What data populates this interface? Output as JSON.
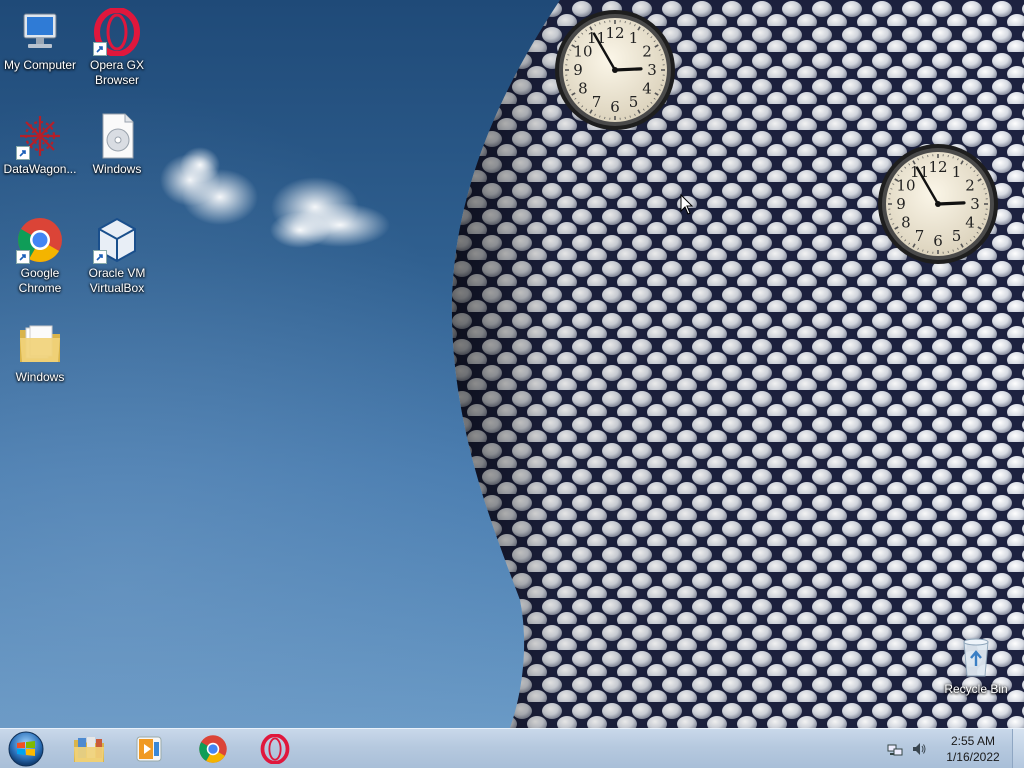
{
  "desktop": {
    "icons": [
      {
        "label": "My Computer",
        "icon": "computer-icon"
      },
      {
        "label": "Opera GX Browser",
        "icon": "opera-gx-icon",
        "shortcut": true
      },
      {
        "label": "DataWagon...",
        "icon": "datawagon-icon",
        "shortcut": true
      },
      {
        "label": "Windows",
        "icon": "disc-image-file-icon"
      },
      {
        "label": "Google Chrome",
        "icon": "chrome-icon",
        "shortcut": true
      },
      {
        "label": "Oracle VM VirtualBox",
        "icon": "virtualbox-icon",
        "shortcut": true
      },
      {
        "label": "Windows",
        "icon": "folder-icon"
      },
      {
        "label": "Recycle Bin",
        "icon": "recycle-bin-icon"
      }
    ],
    "clocks": [
      {
        "name": "clock-gadget-1",
        "hour": 2,
        "minute": 55,
        "numerals": [
          "12",
          "1",
          "2",
          "3",
          "4",
          "5",
          "6",
          "7",
          "8",
          "9",
          "10",
          "11"
        ]
      },
      {
        "name": "clock-gadget-2",
        "hour": 2,
        "minute": 55,
        "numerals": [
          "12",
          "1",
          "2",
          "3",
          "4",
          "5",
          "6",
          "7",
          "8",
          "9",
          "10",
          "11"
        ]
      }
    ]
  },
  "taskbar": {
    "start_button": "start-orb-icon",
    "pinned": [
      {
        "name": "taskbar-explorer",
        "icon": "folder-library-icon"
      },
      {
        "name": "taskbar-media-player",
        "icon": "media-player-icon"
      },
      {
        "name": "taskbar-chrome",
        "icon": "chrome-icon"
      },
      {
        "name": "taskbar-opera",
        "icon": "opera-icon"
      }
    ],
    "tray": {
      "network_icon": "network-icon",
      "volume_icon": "speaker-icon",
      "time": "2:55 AM",
      "date": "1/16/2022"
    }
  },
  "colors": {
    "sky_top": "#1f4a78",
    "sky_bottom": "#6a9ac6",
    "taskbar": "#b6c9df",
    "chrome_red": "#db4437",
    "chrome_green": "#0f9d58",
    "chrome_yellow": "#f4b400",
    "chrome_blue": "#4285f4",
    "opera_red": "#e0173c"
  }
}
